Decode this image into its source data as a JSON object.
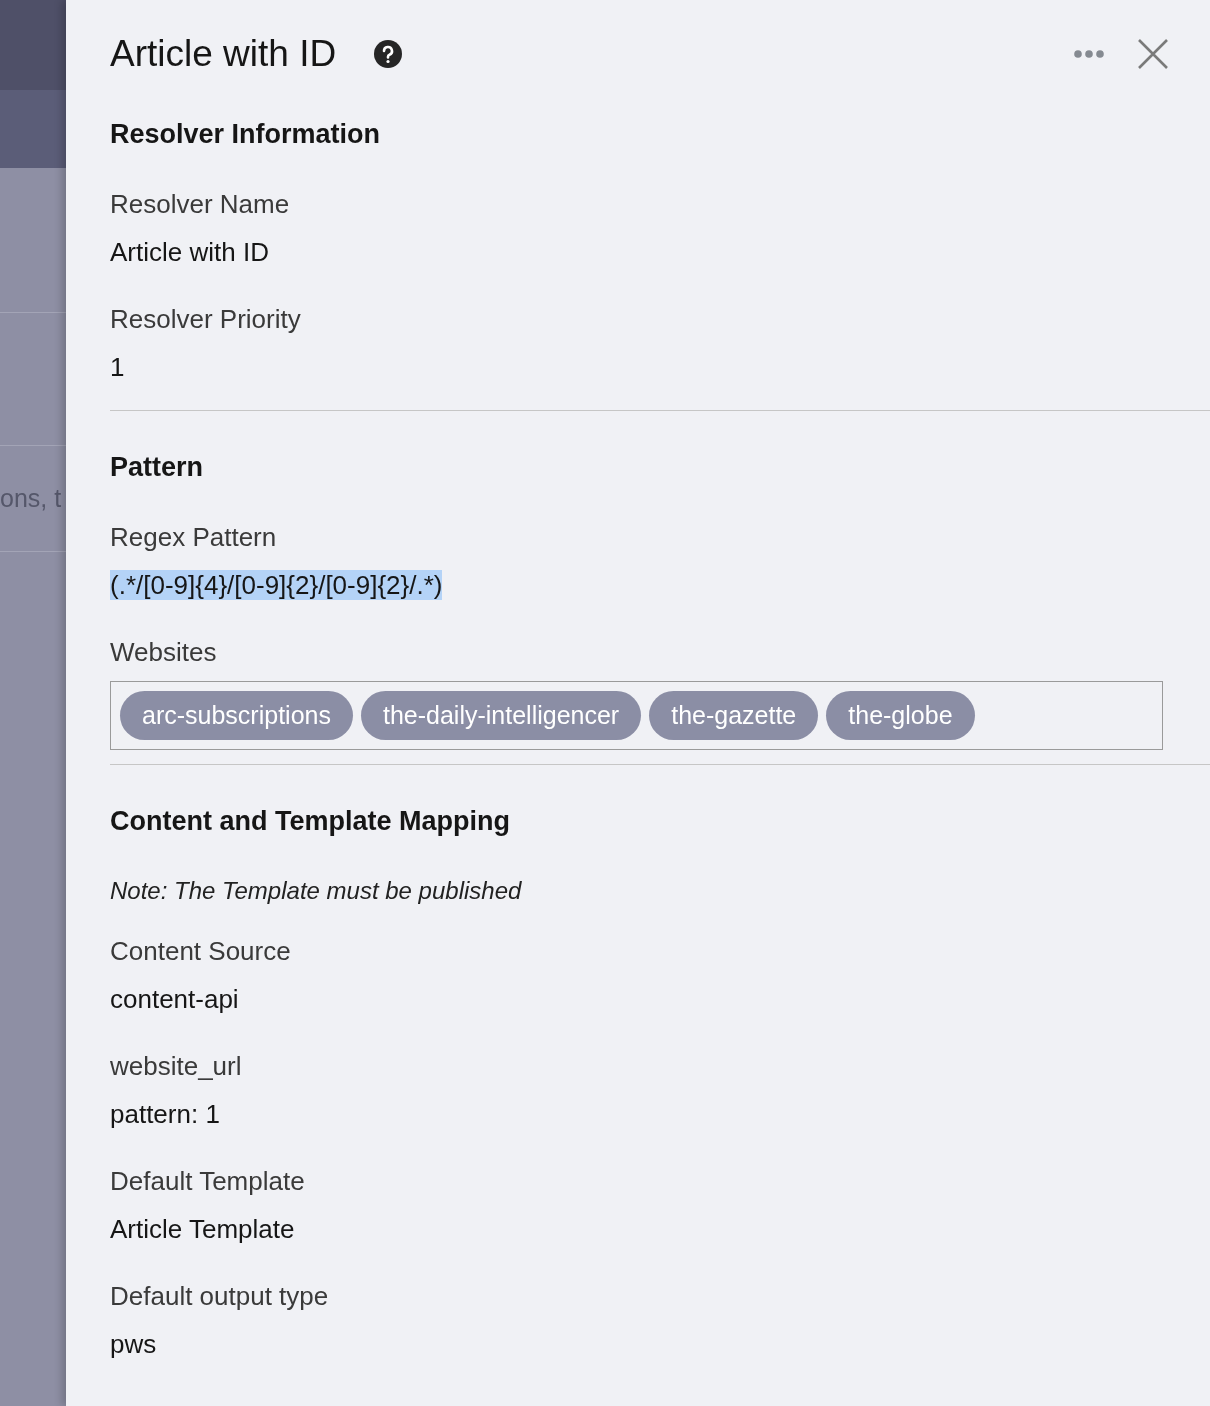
{
  "backdrop": {
    "text": "ons, t"
  },
  "panel": {
    "title": "Article with ID",
    "sections": [
      {
        "heading": "Resolver Information",
        "items": [
          {
            "kind": "field",
            "label": "Resolver Name",
            "value": "Article with ID"
          },
          {
            "kind": "field",
            "label": "Resolver Priority",
            "value": "1"
          }
        ]
      },
      {
        "heading": "Pattern",
        "items": [
          {
            "kind": "field",
            "label": "Regex Pattern",
            "value": "(.*/[0-9]{4}/[0-9]{2}/[0-9]{2}/.*)",
            "selected": true
          },
          {
            "kind": "tags",
            "label": "Websites",
            "tags": [
              "arc-subscriptions",
              "the-daily-intelligencer",
              "the-gazette",
              "the-globe"
            ]
          }
        ]
      },
      {
        "heading": "Content and Template Mapping",
        "items": [
          {
            "kind": "note",
            "text": "Note: The Template must be published"
          },
          {
            "kind": "field",
            "label": "Content Source",
            "value": "content-api"
          },
          {
            "kind": "field",
            "label": "website_url",
            "value": "pattern: 1"
          },
          {
            "kind": "field",
            "label": "Default Template",
            "value": "Article Template"
          },
          {
            "kind": "field",
            "label": "Default output type",
            "value": "pws"
          }
        ]
      }
    ]
  }
}
